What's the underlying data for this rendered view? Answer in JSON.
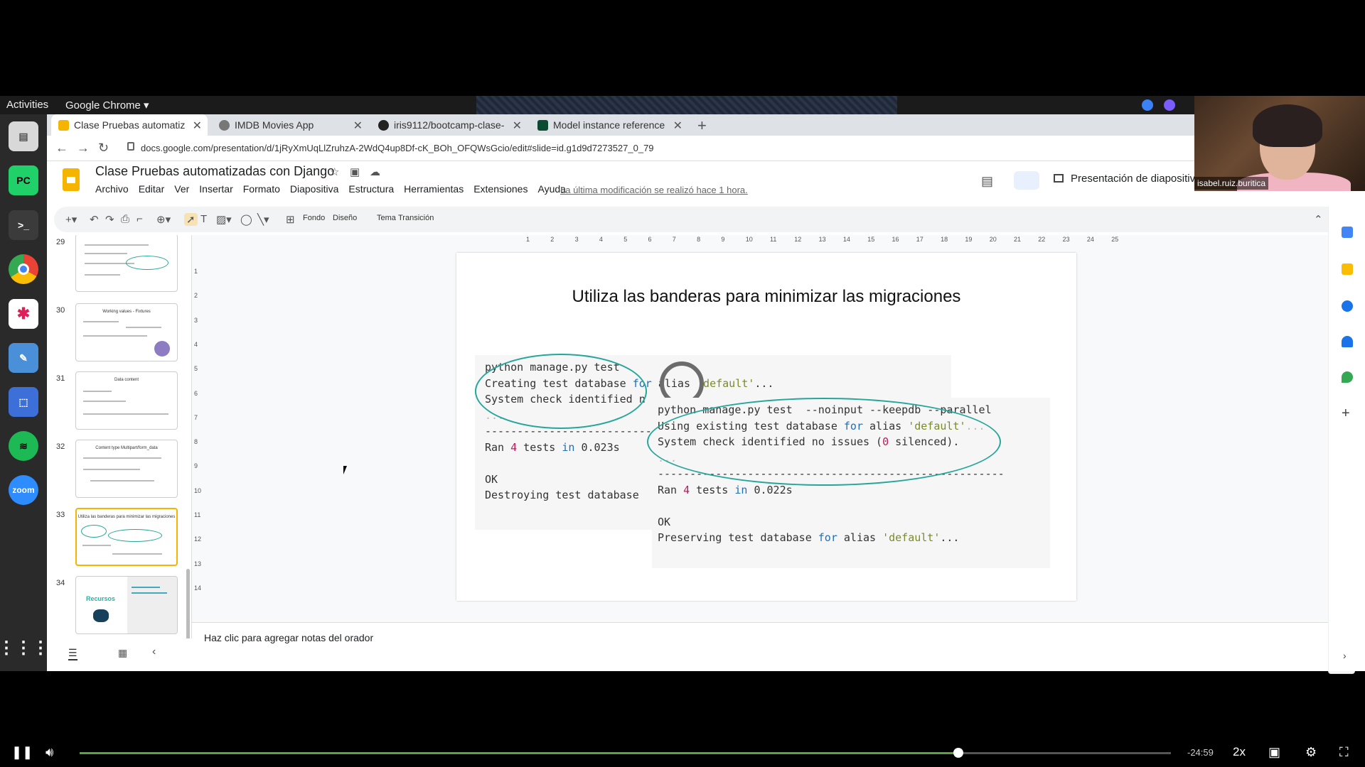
{
  "system": {
    "activities": "Activities",
    "chrome_menu": "Google Chrome"
  },
  "tabs": [
    {
      "label": "Clase Pruebas automatiz",
      "active": true
    },
    {
      "label": "IMDB Movies App",
      "active": false
    },
    {
      "label": "iris9112/bootcamp-clase-",
      "active": false
    },
    {
      "label": "Model instance reference",
      "active": false
    }
  ],
  "address_bar": {
    "url": "docs.google.com/presentation/d/1jRyXmUqLlZruhzA-2WdQ4up8Df-cK_BOh_OFQWsGcio/edit#slide=id.g1d9d7273527_0_79"
  },
  "document": {
    "title": "Clase Pruebas automatizadas con Django",
    "last_modified": "La última modificación se realizó hace 1 hora.",
    "present_button": "Presentación de diapositivas"
  },
  "menu": [
    "Archivo",
    "Editar",
    "Ver",
    "Insertar",
    "Formato",
    "Diapositiva",
    "Estructura",
    "Herramientas",
    "Extensiones",
    "Ayuda"
  ],
  "toolbar": {
    "background": "Fondo",
    "layout": "Diseño",
    "theme": "Tema",
    "transition": "Transición"
  },
  "filmstrip": [
    {
      "number": "29",
      "title": ""
    },
    {
      "number": "30",
      "title": "Working values - Fixtures"
    },
    {
      "number": "31",
      "title": "Data content"
    },
    {
      "number": "32",
      "title": "Content type Multipart/form_data"
    },
    {
      "number": "33",
      "title": "Utiliza las banderas para minimizar las migraciones"
    },
    {
      "number": "34",
      "title": "Recursos"
    }
  ],
  "ruler": {
    "top": [
      "1",
      "2",
      "3",
      "4",
      "5",
      "6",
      "7",
      "8",
      "9",
      "10",
      "11",
      "12",
      "13",
      "14",
      "15",
      "16",
      "17",
      "18",
      "19",
      "20",
      "21",
      "22",
      "23",
      "24",
      "25"
    ],
    "left": [
      "1",
      "2",
      "3",
      "4",
      "5",
      "6",
      "7",
      "8",
      "9",
      "10",
      "11",
      "12",
      "13",
      "14"
    ]
  },
  "slide": {
    "title": "Utiliza las banderas para minimizar las migraciones",
    "block1": {
      "line1": "python manage.py test",
      "line2a": "Creating test database ",
      "line2kw": "for",
      "line2b": " alias ",
      "line2str": "'default'",
      "line2c": "...",
      "line3": "System check identified n",
      "dots": "...",
      "dashes": "----------------------------",
      "ran_a": "Ran ",
      "ran_num": "4",
      "ran_b": " tests ",
      "ran_kw": "in",
      "ran_c": " 0.023s",
      "ok": "OK",
      "destroy": "Destroying test database"
    },
    "block2": {
      "line1": "python manage.py test  --noinput --keepdb --parallel",
      "line2a": "Using existing test database ",
      "line2kw": "for",
      "line2b": " alias ",
      "line2str": "'default'",
      "line2c": "...",
      "line3a": "System check identified no issues (",
      "line3num": "0",
      "line3b": " silenced).",
      "dots": "...",
      "dashes": "------------------------------------------------------",
      "ran_a": "Ran ",
      "ran_num": "4",
      "ran_b": " tests ",
      "ran_kw": "in",
      "ran_c": " 0.022s",
      "ok": "OK",
      "pres_a": "Preserving test database ",
      "pres_kw": "for",
      "pres_b": " alias ",
      "pres_str": "'default'",
      "pres_c": "..."
    }
  },
  "notes": {
    "placeholder": "Haz clic para agregar notas del orador"
  },
  "webcam": {
    "name": "isabel.ruiz.buritica"
  },
  "player": {
    "time_remaining": "-24:59",
    "speed": "2x",
    "progress": 0.805
  },
  "colors": {
    "accent_yellow": "#f4b400",
    "ellipse_teal": "#26a69a",
    "keyword_blue": "#1f6fb8",
    "number_pink": "#c2185b",
    "string_olive": "#7a8b2a",
    "progress_green": "#5ba33f"
  }
}
